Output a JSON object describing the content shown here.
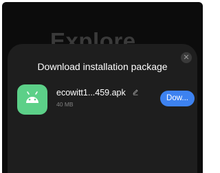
{
  "background": {
    "title": "Explore"
  },
  "dialog": {
    "title": "Download installation package",
    "close_icon": "close-icon",
    "file": {
      "name": "ecowitt1...459.apk",
      "size": "40 MB",
      "app_icon": "android-icon",
      "edit_icon": "pencil-icon"
    },
    "download_label": "Dow..."
  },
  "colors": {
    "sheet": "#1e1e1e",
    "accent": "#3d82f0",
    "app_icon": "#5cd088"
  }
}
